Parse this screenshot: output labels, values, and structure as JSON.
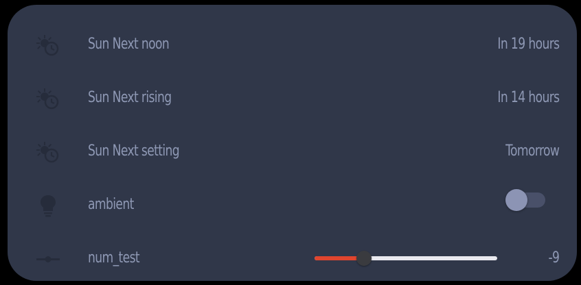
{
  "colors": {
    "card_background": "#303749",
    "text": "#8e98b4",
    "icon": "#262c3b",
    "slider_fill": "#e0452e",
    "slider_rail": "#e9e9ef",
    "toggle_knob": "#8c94b4"
  },
  "entities": [
    {
      "icon": "weather-sunset-clock-icon",
      "label": "Sun Next noon",
      "value": "In 19 hours"
    },
    {
      "icon": "weather-sunset-clock-icon",
      "label": "Sun Next rising",
      "value": "In 14 hours"
    },
    {
      "icon": "weather-sunset-clock-icon",
      "label": "Sun Next setting",
      "value": "Tomorrow"
    },
    {
      "icon": "lightbulb-icon",
      "label": "ambient",
      "state": "off"
    },
    {
      "icon": "ray-vertex-icon",
      "label": "num_test",
      "value": "-9",
      "slider_fraction": 0.27
    }
  ]
}
